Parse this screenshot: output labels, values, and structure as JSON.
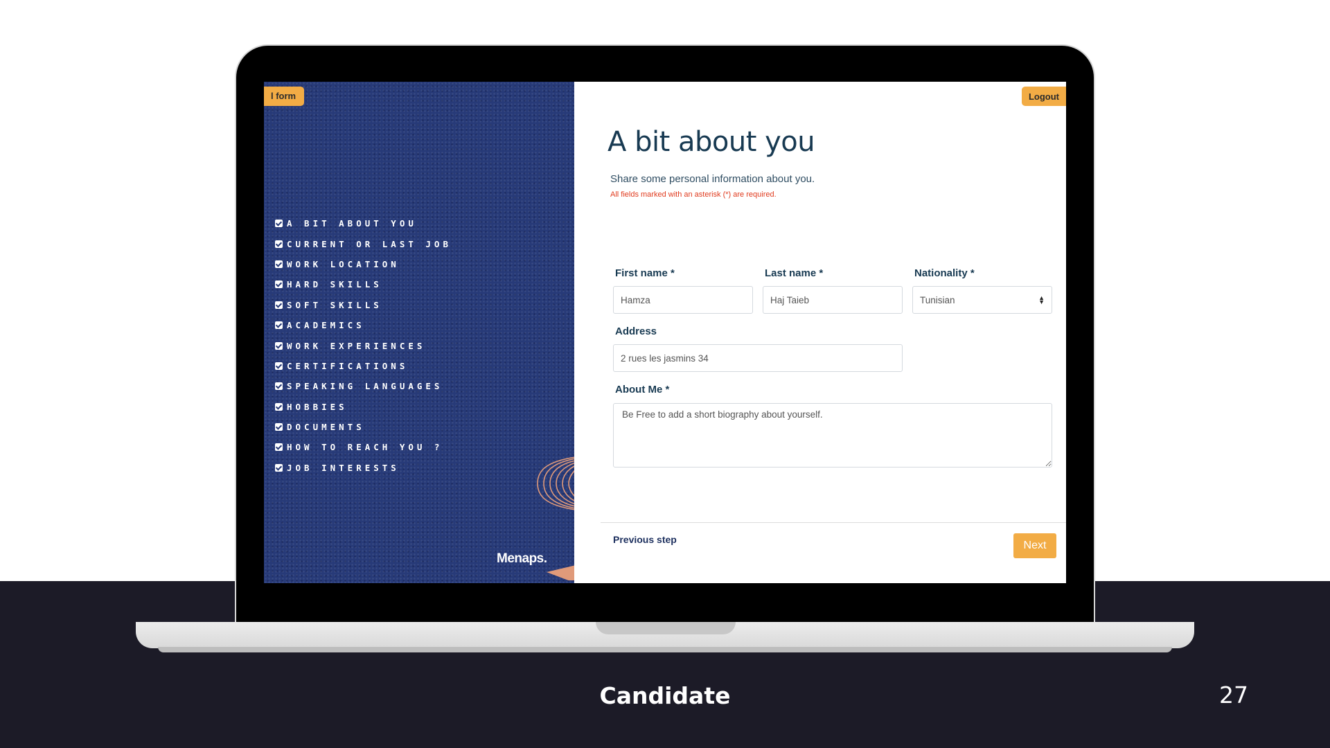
{
  "left_panel": {
    "tag_label": "l form",
    "steps": [
      "A bit about you",
      "Current or last job",
      "Work location",
      "Hard skills",
      "Soft skills",
      "Academics",
      "Work experiences",
      "Certifications",
      "Speaking languages",
      "Hobbies",
      "Documents",
      "How to reach you ?",
      "Job interests"
    ],
    "brand": "Menaps."
  },
  "header": {
    "logout_label": "Logout"
  },
  "form": {
    "title": "A bit about you",
    "subtitle": "Share some personal information about you.",
    "required_note": "All fields marked with an asterisk (*) are required.",
    "first_name": {
      "label": "First name *",
      "value": "Hamza"
    },
    "last_name": {
      "label": "Last name *",
      "value": "Haj Taieb"
    },
    "nationality": {
      "label": "Nationality *",
      "value": "Tunisian"
    },
    "address": {
      "label": "Address",
      "value": "2 rues les jasmins 34"
    },
    "about": {
      "label": "About Me *",
      "placeholder": "Be Free to add a short biography about yourself."
    }
  },
  "nav": {
    "previous_label": "Previous step",
    "next_label": "Next"
  },
  "slide": {
    "title": "Candidate",
    "page": "27"
  },
  "colors": {
    "accent": "#f2ac45",
    "panel": "#273a78",
    "heading": "#183a52",
    "dark_band": "#1c1b27",
    "error": "#e03a1d"
  }
}
